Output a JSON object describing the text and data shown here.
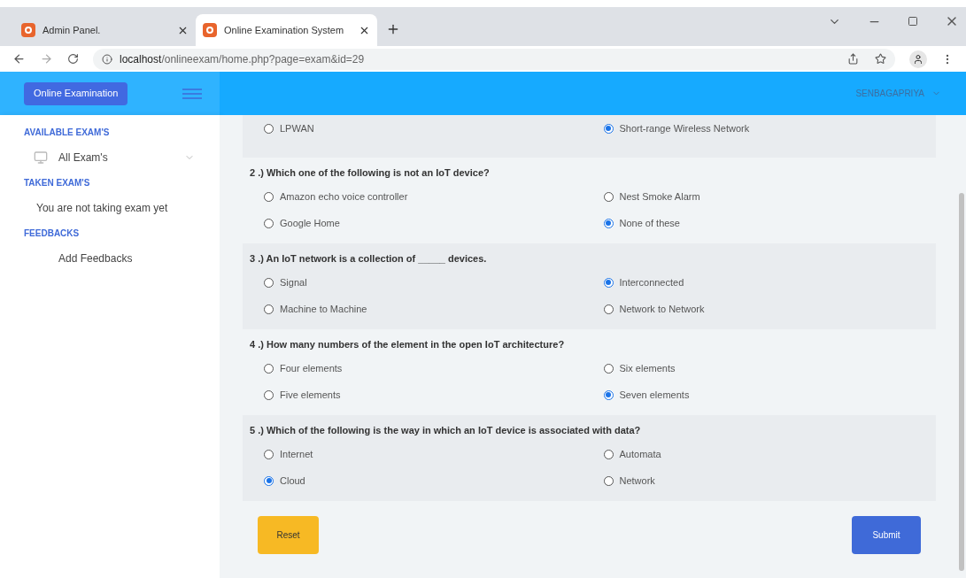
{
  "browser": {
    "tabs": [
      {
        "title": "Admin Panel.",
        "selected": false
      },
      {
        "title": "Online Examination System",
        "selected": true
      }
    ],
    "address": {
      "host": "localhost",
      "path": "/onlineexam/home.php?page=exam&id=29"
    }
  },
  "header": {
    "brand": "Online Examination",
    "user": "SENBAGAPRIYA"
  },
  "sidebar": {
    "sections": [
      {
        "heading": "AVAILABLE EXAM'S",
        "items": [
          {
            "label": "All Exam's",
            "kind": "dropdown"
          }
        ]
      },
      {
        "heading": "TAKEN EXAM'S",
        "items": [
          {
            "label": "You are not taking exam yet",
            "kind": "note"
          }
        ]
      },
      {
        "heading": "FEEDBACKS",
        "items": [
          {
            "label": "Add Feedbacks",
            "kind": "link"
          }
        ]
      }
    ]
  },
  "questions": [
    {
      "options": [
        {
          "label": "LPWAN",
          "selected": false
        },
        {
          "label": "Short-range Wireless Network",
          "selected": true
        }
      ]
    },
    {
      "title": "2 .) Which one of the following is not an IoT device?",
      "options": [
        {
          "label": "Amazon echo voice controller",
          "selected": false
        },
        {
          "label": "Nest Smoke Alarm",
          "selected": false
        },
        {
          "label": "Google Home",
          "selected": false
        },
        {
          "label": "None of these",
          "selected": true
        }
      ]
    },
    {
      "title": "3 .) An IoT network is a collection of _____ devices.",
      "options": [
        {
          "label": "Signal",
          "selected": false
        },
        {
          "label": "Interconnected",
          "selected": true
        },
        {
          "label": "Machine to Machine",
          "selected": false
        },
        {
          "label": "Network to Network",
          "selected": false
        }
      ]
    },
    {
      "title": "4 .) How many numbers of the element in the open IoT architecture?",
      "options": [
        {
          "label": "Four elements",
          "selected": false
        },
        {
          "label": "Six elements",
          "selected": false
        },
        {
          "label": "Five elements",
          "selected": false
        },
        {
          "label": "Seven elements",
          "selected": true
        }
      ]
    },
    {
      "title": "5 .) Which of the following is the way in which an IoT device is associated with data?",
      "options": [
        {
          "label": "Internet",
          "selected": false
        },
        {
          "label": "Automata",
          "selected": false
        },
        {
          "label": "Cloud",
          "selected": true
        },
        {
          "label": "Network",
          "selected": false
        }
      ]
    }
  ],
  "buttons": {
    "reset": "Reset",
    "submit": "Submit"
  }
}
